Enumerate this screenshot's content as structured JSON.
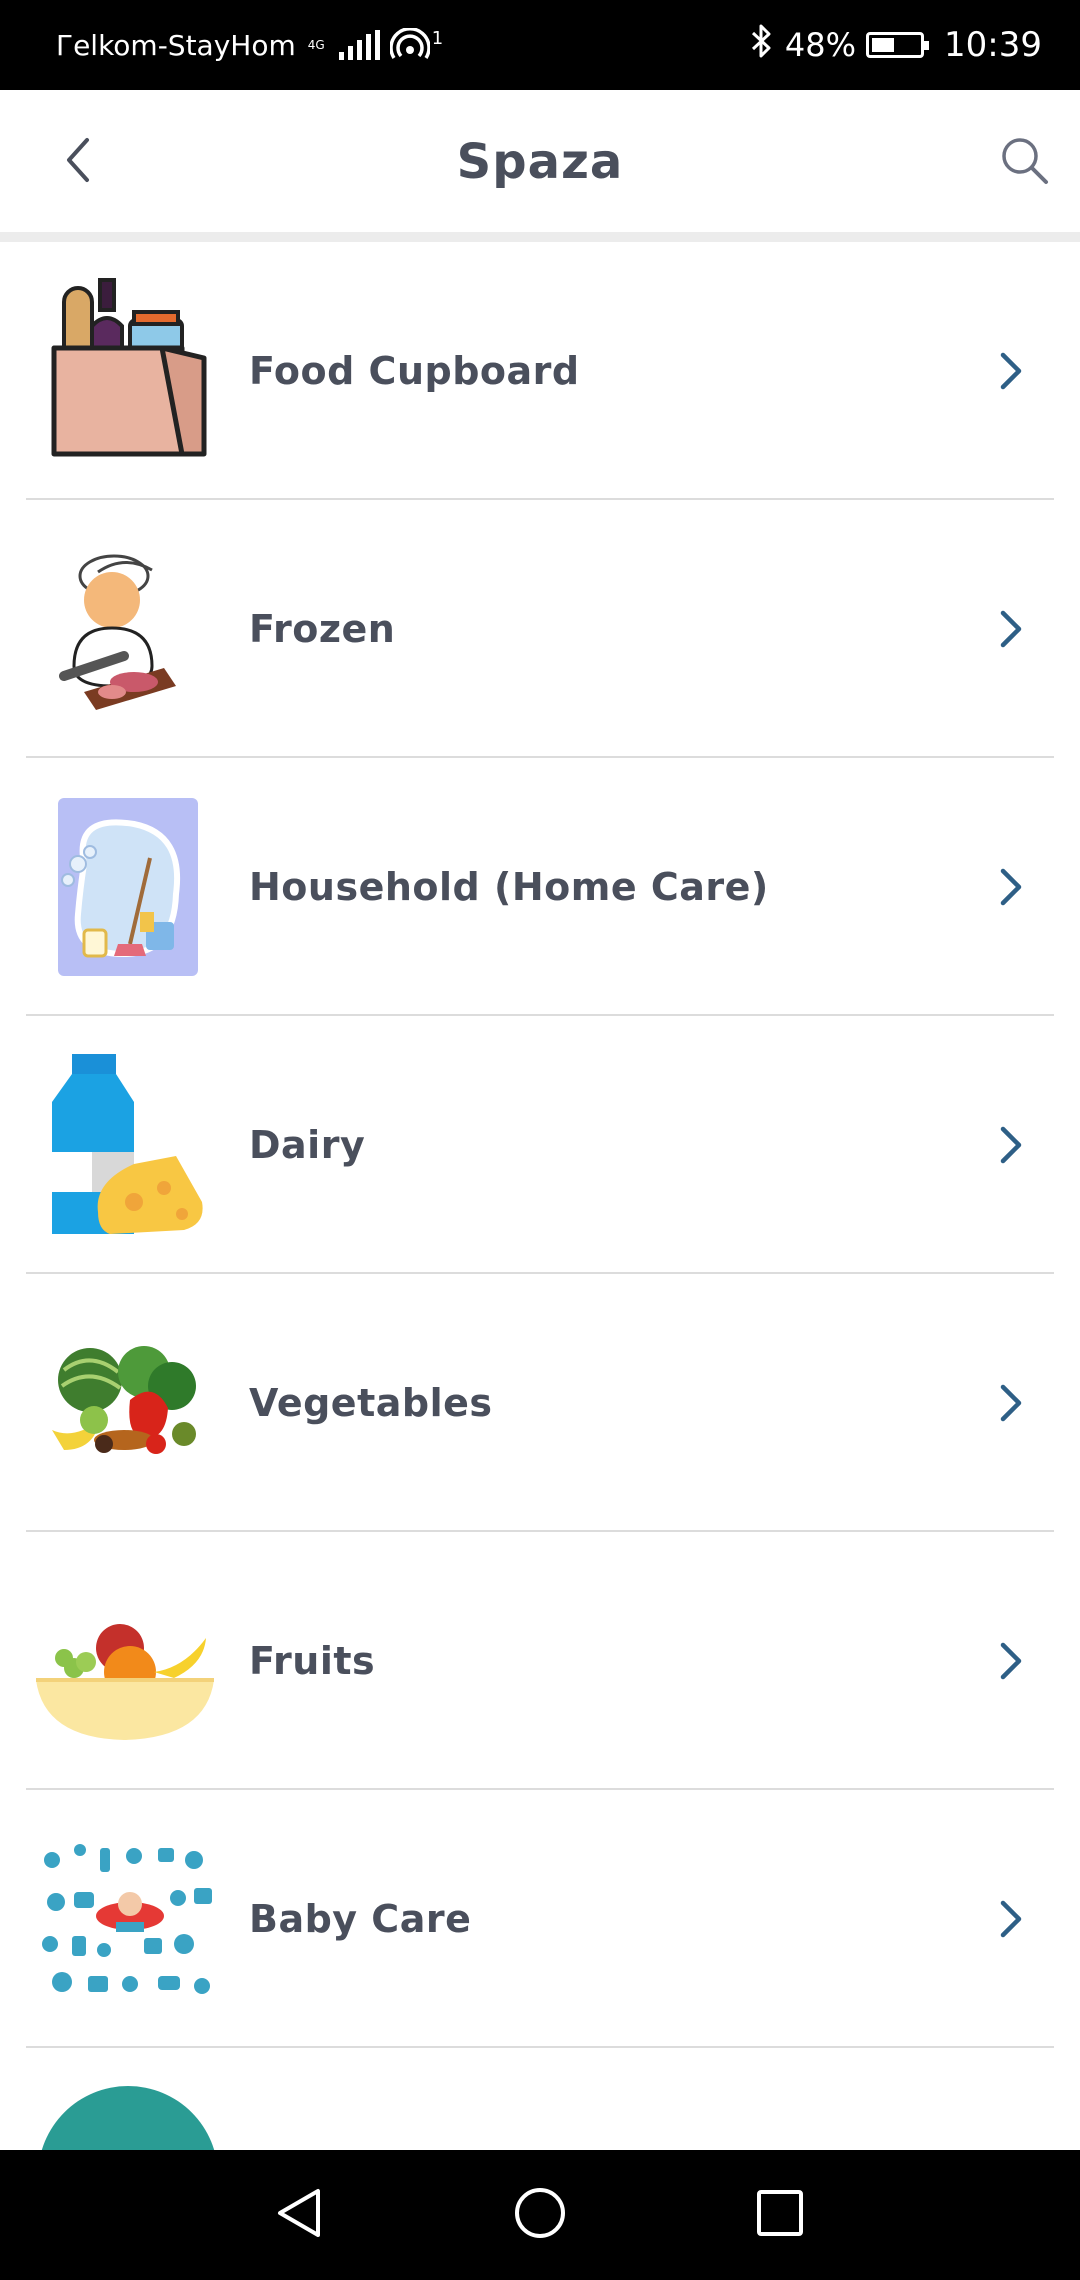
{
  "status_bar": {
    "carrier": "Гelkom-StayHom",
    "network": "4G",
    "hotspot_count": "1",
    "battery_percent": "48%",
    "battery_level": 0.48,
    "time": "10:39"
  },
  "header": {
    "title": "Spaza",
    "back_icon": "chevron-left-icon",
    "search_icon": "search-icon"
  },
  "categories": [
    {
      "label": "Food Cupboard",
      "icon": "grocery-bag-icon"
    },
    {
      "label": "Frozen",
      "icon": "butcher-icon"
    },
    {
      "label": "Household (Home Care)",
      "icon": "cleaning-icon"
    },
    {
      "label": "Dairy",
      "icon": "milk-cheese-icon"
    },
    {
      "label": "Vegetables",
      "icon": "vegetables-icon"
    },
    {
      "label": "Fruits",
      "icon": "fruit-bowl-icon"
    },
    {
      "label": "Baby Care",
      "icon": "baby-items-icon"
    }
  ],
  "colors": {
    "text": "#4a4f5c",
    "chevron": "#2e5f86",
    "divider": "#dcdcdc"
  }
}
